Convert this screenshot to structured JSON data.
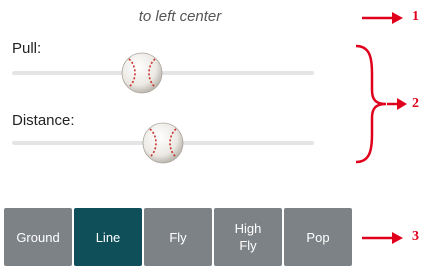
{
  "header": {
    "subtitle": "to left center"
  },
  "sliders": [
    {
      "label": "Pull:",
      "value": 0.43
    },
    {
      "label": "Distance:",
      "value": 0.5
    }
  ],
  "tabs": [
    {
      "label": "Ground",
      "active": false
    },
    {
      "label": "Line",
      "active": true
    },
    {
      "label": "Fly",
      "active": false
    },
    {
      "label": "High\nFly",
      "active": false
    },
    {
      "label": "Pop",
      "active": false
    }
  ],
  "annotations": {
    "callout_1": "1",
    "callout_2": "2",
    "callout_3": "3",
    "color": "#e0001b"
  },
  "icons": {
    "slider_thumb": "baseball-icon"
  }
}
